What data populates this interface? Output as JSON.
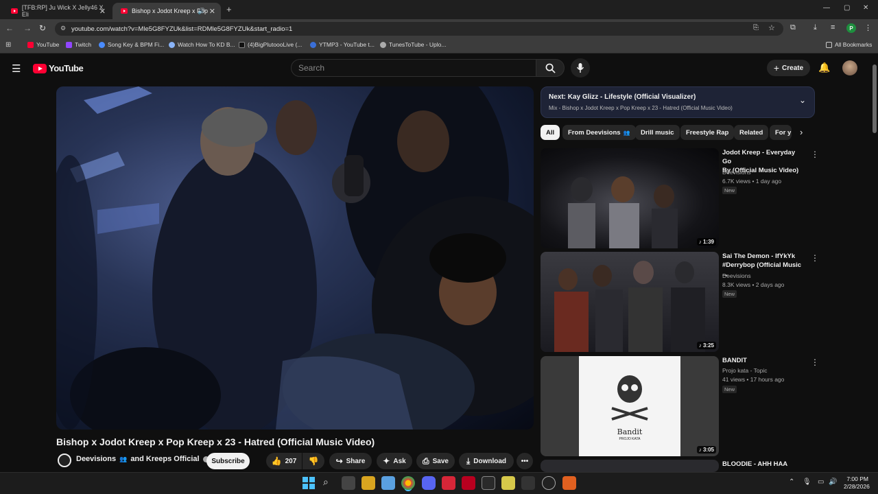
{
  "browser": {
    "tabs": [
      {
        "label": "[TFB:RP] Ju Wick X Jelly46 X Eli",
        "active": false
      },
      {
        "label": "Bishop x Jodot Kreep x Pop",
        "active": true
      }
    ],
    "url": "youtube.com/watch?v=Mle5G8FYZUk&list=RDMle5G8FYZUk&start_radio=1",
    "bookmarks": [
      "YouTube",
      "Twitch",
      "Song Key & BPM Fi...",
      "Watch How To KD B...",
      "(4)BigPlutoooLive (...",
      "YTMP3 - YouTube t...",
      "TunesToTube - Uplo..."
    ],
    "all_bookmarks": "All Bookmarks",
    "profile_initial": "P"
  },
  "youtube": {
    "logo": "YouTube",
    "search_placeholder": "Search",
    "create_label": "Create"
  },
  "video": {
    "title": "Bishop x Jodot Kreep x Pop Kreep x 23 - Hatred (Official Music Video)",
    "channel": "Deevisions",
    "channel_suffix": "and Kreeps Official",
    "subscribe": "Subscribe",
    "likes": "207",
    "share": "Share",
    "ask": "Ask",
    "save": "Save",
    "download": "Download"
  },
  "up_next": {
    "title": "Next: Kay Glizz - Lifestyle (Official Visualizer)",
    "subtitle": "Mix - Bishop x Jodot Kreep x Pop Kreep x 23 - Hatred (Official Music Video)"
  },
  "filters": [
    "All",
    "From Deevisions",
    "Drill music",
    "Freestyle Rap",
    "Related",
    "For y"
  ],
  "recommendations": [
    {
      "title_line1": "Jodot Kreep - Everyday Go",
      "title_line2": "By (Official Music Video)",
      "channel": "Deevisions",
      "meta": "6.7K views • 1 day ago",
      "badge": "New",
      "duration": "1:39"
    },
    {
      "title_line1": "Sai The Demon - IfYkYk",
      "title_line2": "#Derrybop (Official Music ...",
      "channel": "Deevisions",
      "meta": "8.3K views • 2 days ago",
      "badge": "New",
      "duration": "3:25"
    },
    {
      "title_line1": "BANDIT",
      "title_line2": "",
      "channel": "Projo kata - Topic",
      "meta": "41 views • 17 hours ago",
      "badge": "New",
      "duration": "3:05",
      "thumb_text": "Bandit",
      "thumb_subtext": "PROJO KATA"
    },
    {
      "title_line1": "BLOODIE - AHH HAA",
      "title_line2": "",
      "channel": "",
      "meta": "",
      "badge": "",
      "duration": ""
    }
  ],
  "taskbar": {
    "time": "7:00 PM",
    "date": "2/28/2026"
  },
  "colors": {
    "youtube_red": "#ff0033",
    "background": "#0f0f0f",
    "chip_bg": "#272727"
  }
}
